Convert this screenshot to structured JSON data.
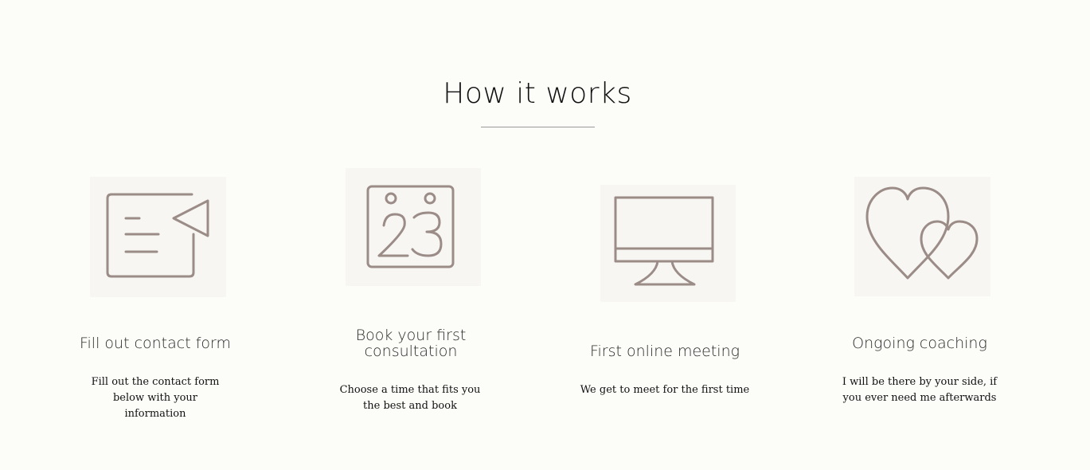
{
  "section": {
    "title": "How it works"
  },
  "steps": [
    {
      "icon": "contact-form-icon",
      "title": "Fill out contact form",
      "description": "Fill out the contact form below with your information"
    },
    {
      "icon": "calendar-icon",
      "title": "Book your first consultation",
      "description": "Choose a time that fits you the best and book"
    },
    {
      "icon": "monitor-icon",
      "title": "First online meeting",
      "description": "We get to meet for the first time"
    },
    {
      "icon": "hearts-icon",
      "title": "Ongoing coaching",
      "description": "I will be there by your side, if you ever need me afterwards"
    }
  ],
  "colors": {
    "background": "#fcfcf9",
    "icon_stroke": "#9b8c87",
    "icon_bg": "#f7f6f2",
    "divider": "#9a9a9a"
  }
}
